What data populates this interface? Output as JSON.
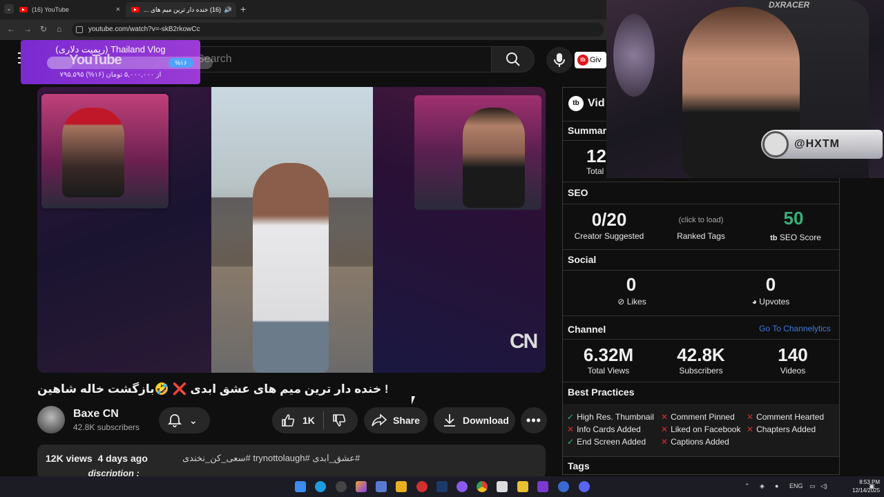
{
  "browser": {
    "tabs": [
      {
        "title": "(16) YouTube"
      },
      {
        "title": "(16) خنده دار ترین میم های ..."
      }
    ],
    "url": "youtube.com/watch?v=-skB2rkowCc"
  },
  "youtube": {
    "search_placeholder": "Search",
    "logo_text": "YouTube",
    "tubebuddy_btn": "Giv"
  },
  "stream_overlay": {
    "title": "(ریمیت دلاری) Thailand Vlog",
    "percent": "%۱۶",
    "progress_fraction": 0.16,
    "amount": "۷۹۵,۵۹۵ از ۵,۰۰۰,۰۰۰ تومان (۱۶%)"
  },
  "video": {
    "title": "! خنده دار ترین میم های عشق ابدی ❌ 🤣بازگشت خاله شاهین",
    "watermark": "CN",
    "channel": "Baxe CN",
    "subscribers": "42.8K subscribers",
    "likes": "1K",
    "share": "Share",
    "download": "Download",
    "views": "12K views",
    "age": "4 days ago",
    "tags": "#عشق_ابدی #trynottolaugh #سعی_کن_نخندی",
    "desc_line2": "________ discription : ________"
  },
  "panel": {
    "header": "Vid",
    "summary_label": "Summar",
    "summary_value": "12",
    "summary_sub": "Total",
    "seo": {
      "label": "SEO",
      "creator_value": "0/20",
      "creator_label": "Creator Suggested",
      "ranked_hint": "(click to load)",
      "ranked_label": "Ranked Tags",
      "score_value": "50",
      "score_label": "SEO Score"
    },
    "social": {
      "label": "Social",
      "likes_value": "0",
      "likes_label": "Likes",
      "upvotes_value": "0",
      "upvotes_label": "Upvotes"
    },
    "channel": {
      "label": "Channel",
      "link": "Go To Channelytics",
      "views_value": "6.32M",
      "views_label": "Total Views",
      "subs_value": "42.8K",
      "subs_label": "Subscribers",
      "videos_value": "140",
      "videos_label": "Videos"
    },
    "best_practices": {
      "label": "Best Practices",
      "items": [
        {
          "text": "High Res. Thumbnail",
          "ok": true
        },
        {
          "text": "Comment Pinned",
          "ok": false
        },
        {
          "text": "Comment Hearted",
          "ok": false
        },
        {
          "text": "Info Cards Added",
          "ok": false
        },
        {
          "text": "Liked on Facebook",
          "ok": false
        },
        {
          "text": "Chapters Added",
          "ok": false
        },
        {
          "text": "End Screen Added",
          "ok": true
        },
        {
          "text": "Captions Added",
          "ok": false
        }
      ]
    },
    "tags_label": "Tags",
    "colors": {
      "ok": "#2fbf71",
      "no": "#d03030",
      "score": "#3aaf7a",
      "link": "#3d7be0"
    }
  },
  "webcam": {
    "brand": "DXRACER",
    "badge": "@HXTM"
  },
  "taskbar": {
    "lang": "ENG",
    "time": "8:53 PM",
    "date": "12/14/2025"
  }
}
